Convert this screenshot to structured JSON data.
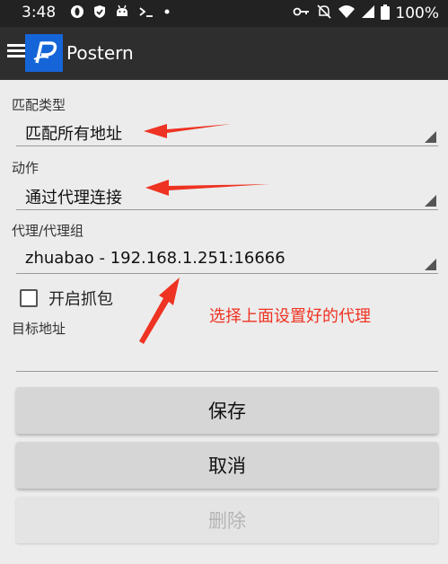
{
  "status_bar": {
    "time": "3:48",
    "battery": "100%",
    "icons_left": [
      "opera-icon",
      "shield-icon",
      "android-icon",
      "terminal-icon",
      "dot-icon"
    ],
    "icons_right": [
      "key-icon",
      "mute-icon",
      "wifi-icon",
      "signal-icon",
      "battery-icon"
    ]
  },
  "app_bar": {
    "title": "Postern",
    "logo_letter": "P"
  },
  "form": {
    "match_type_label": "匹配类型",
    "match_type_value": "匹配所有地址",
    "action_label": "动作",
    "action_value": "通过代理连接",
    "proxy_label": "代理/代理组",
    "proxy_value": "zhuabao - 192.168.1.251:16666",
    "capture_label": "开启抓包",
    "capture_checked": false,
    "target_label": "目标地址",
    "target_value": ""
  },
  "buttons": {
    "save": "保存",
    "cancel": "取消",
    "delete": "删除"
  },
  "annotation": {
    "text": "选择上面设置好的代理",
    "color": "#ee3322"
  }
}
